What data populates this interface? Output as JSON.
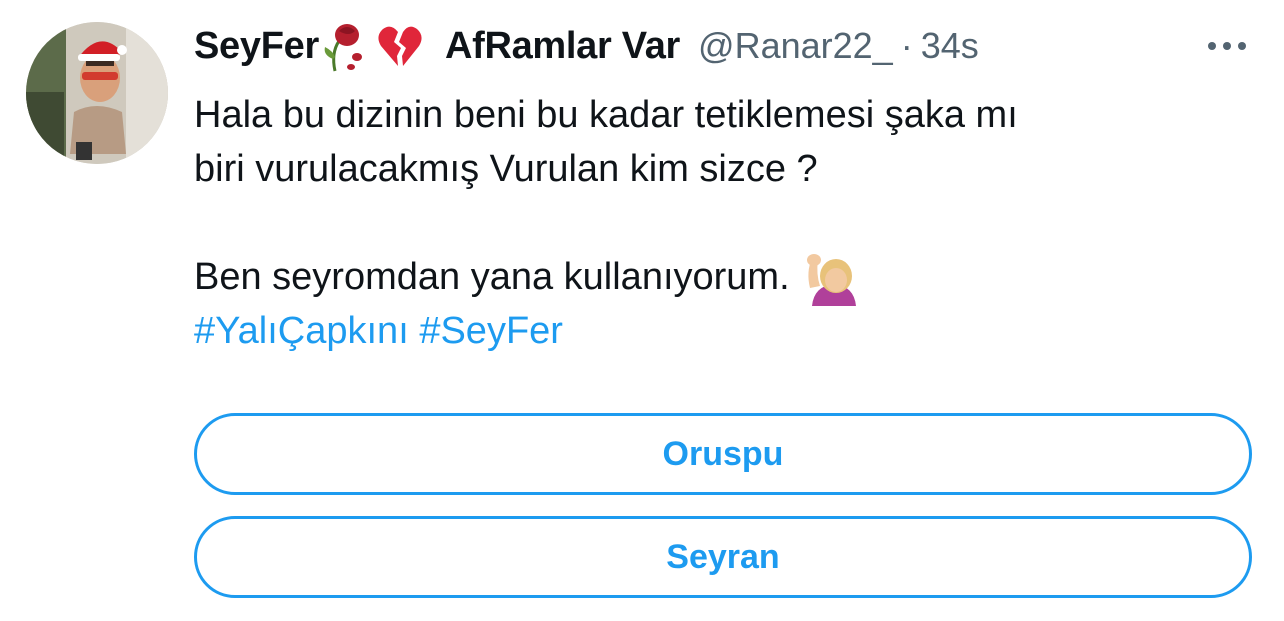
{
  "tweet": {
    "display_name": "SeyFer",
    "display_name_suffix": "AfRamlar Var",
    "handle": "@Ranar22_",
    "separator": "·",
    "time": "34s",
    "text_lines": [
      "Hala bu dizinin beni bu kadar tetiklemesi şaka mı",
      "biri vurulacakmış Vurulan kim sizce ?"
    ],
    "text_line_3": "Ben seyromdan yana kullanıyorum.",
    "hashtags": [
      "#YalıÇapkını",
      "#SeyFer"
    ],
    "icons": {
      "avatar": "profile-photo",
      "rose": "wilted-rose-emoji",
      "heart": "broken-heart-emoji",
      "raise": "person-raising-hand-emoji",
      "more": "more-dots-icon"
    },
    "colors": {
      "accent": "#1d9bf0",
      "secondary_text": "#536471",
      "primary_text": "#0f1419"
    }
  },
  "poll": {
    "options": [
      "Oruspu",
      "Seyran"
    ]
  }
}
